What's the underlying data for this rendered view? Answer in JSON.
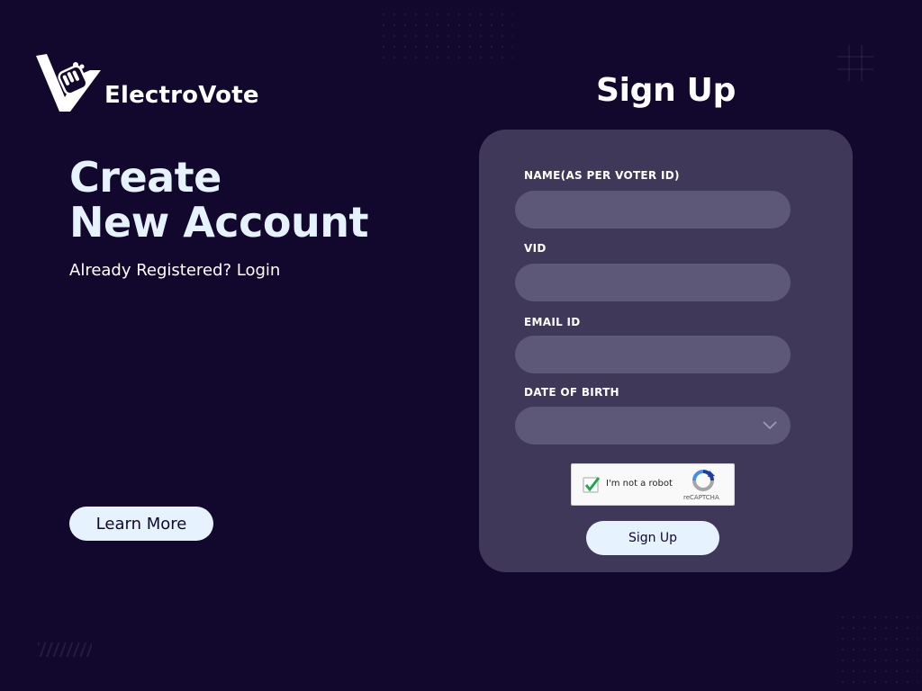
{
  "brand": {
    "name": "ElectroVote",
    "logo_icon": "hand-ballot-logo-icon"
  },
  "hero": {
    "title_line1": "Create",
    "title_line2": "New Account",
    "already_text": "Already Registered?",
    "login_link": "Login",
    "learn_more": "Learn More"
  },
  "form": {
    "title": "Sign Up",
    "fields": [
      {
        "label": "NAME(AS PER VOTER ID)",
        "value": "",
        "placeholder": ""
      },
      {
        "label": "VID",
        "value": "",
        "placeholder": ""
      },
      {
        "label": "EMAIL ID",
        "value": "",
        "placeholder": ""
      },
      {
        "label": "DATE OF BIRTH",
        "value": "",
        "placeholder": "",
        "icon": "chevron-down-icon"
      }
    ],
    "recaptcha": {
      "label": "I'm not a robot",
      "brand": "reCAPTCHA",
      "checked": true
    },
    "submit": "Sign Up"
  },
  "colors": {
    "background": "#12082e",
    "card": "#3f3859",
    "input": "#5d5877",
    "button": "#e6f3ff",
    "heading": "#e6f3ff"
  }
}
